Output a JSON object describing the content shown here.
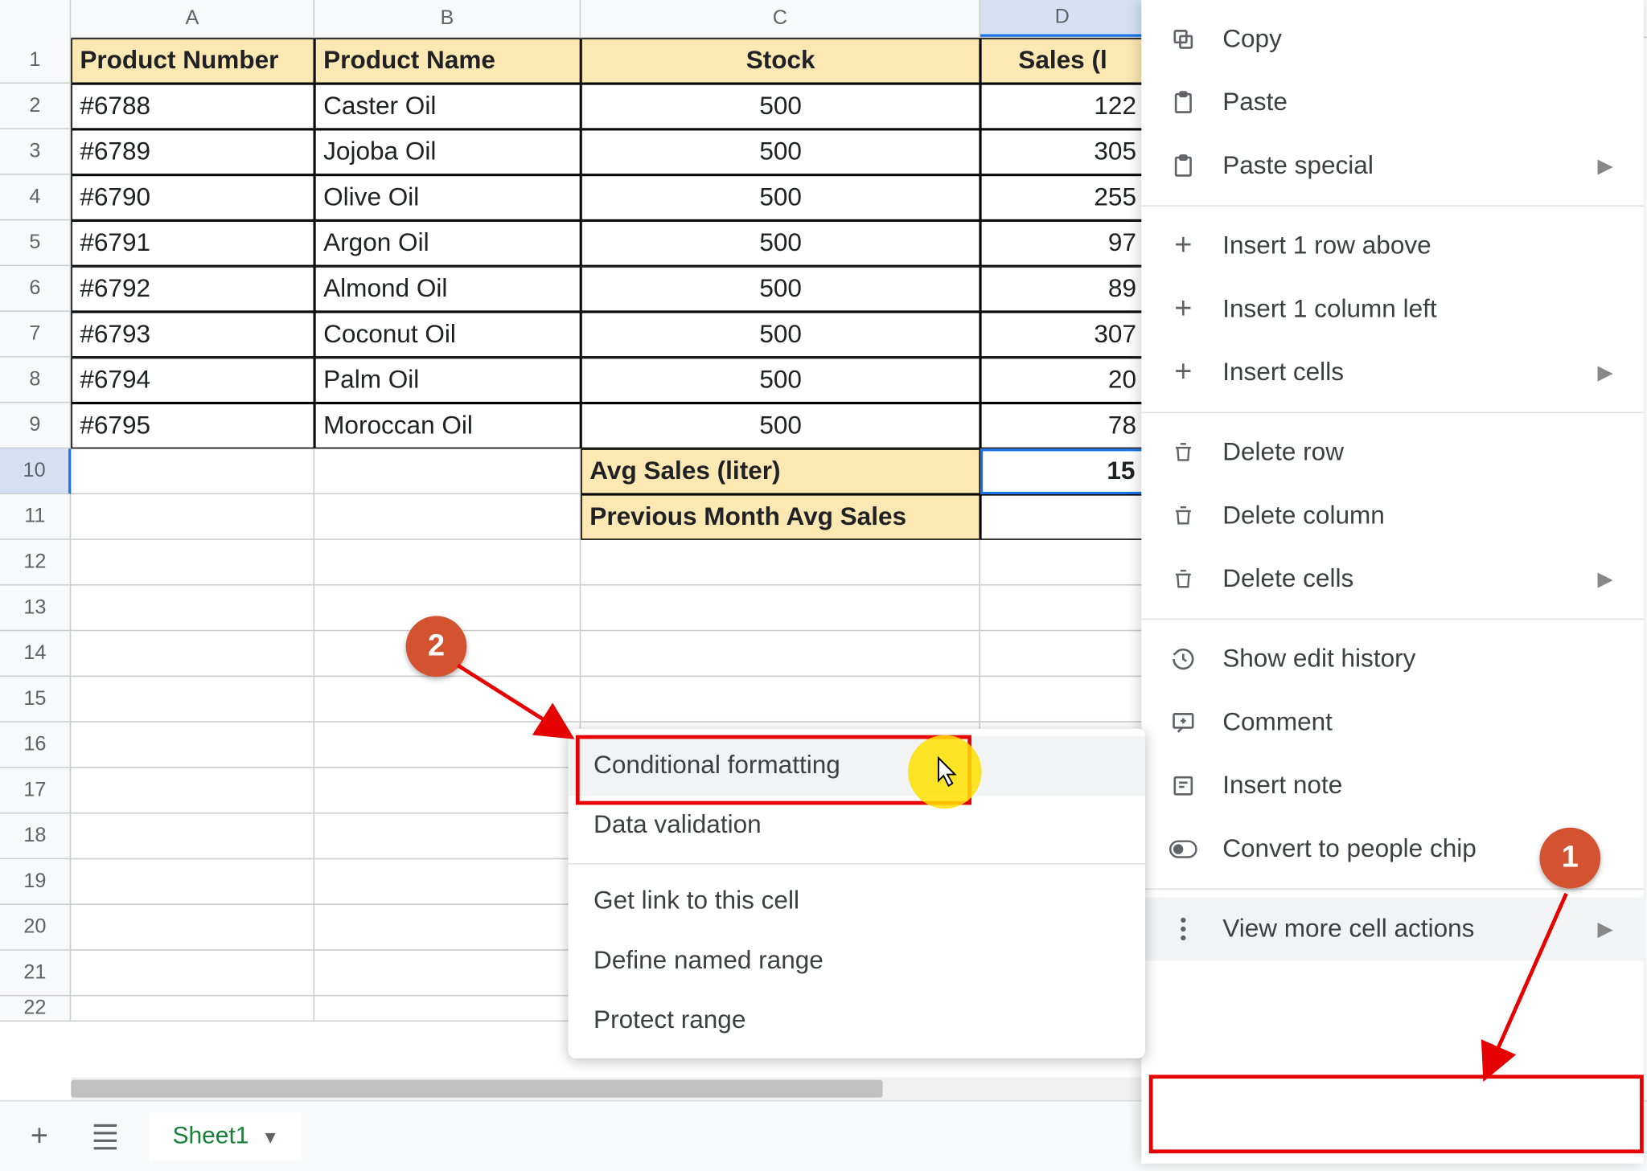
{
  "columns": [
    "A",
    "B",
    "C",
    "D"
  ],
  "rowNums": [
    1,
    2,
    3,
    4,
    5,
    6,
    7,
    8,
    9,
    10,
    11,
    12,
    13,
    14,
    15,
    16,
    17,
    18,
    19,
    20,
    21,
    22
  ],
  "headers": {
    "A": "Product Number",
    "B": "Product Name",
    "C": "Stock",
    "D": "Sales (l"
  },
  "data": [
    {
      "pn": "#6788",
      "name": "Caster Oil",
      "stock": "500",
      "sales": "122"
    },
    {
      "pn": "#6789",
      "name": "Jojoba Oil",
      "stock": "500",
      "sales": "305"
    },
    {
      "pn": "#6790",
      "name": "Olive Oil",
      "stock": "500",
      "sales": "255"
    },
    {
      "pn": "#6791",
      "name": "Argon Oil",
      "stock": "500",
      "sales": "97"
    },
    {
      "pn": "#6792",
      "name": "Almond Oil",
      "stock": "500",
      "sales": "89"
    },
    {
      "pn": "#6793",
      "name": "Coconut Oil",
      "stock": "500",
      "sales": "307"
    },
    {
      "pn": "#6794",
      "name": "Palm Oil",
      "stock": "500",
      "sales": "20"
    },
    {
      "pn": "#6795",
      "name": "Moroccan Oil",
      "stock": "500",
      "sales": "78"
    }
  ],
  "summary": {
    "avgLabel": "Avg Sales (liter)",
    "avgVal": "15",
    "prevLabel": "Previous Month Avg Sales"
  },
  "mainMenu": {
    "copy": "Copy",
    "paste": "Paste",
    "pasteSpecial": "Paste special",
    "insertRow": "Insert 1 row above",
    "insertCol": "Insert 1 column left",
    "insertCells": "Insert cells",
    "delRow": "Delete row",
    "delCol": "Delete column",
    "delCells": "Delete cells",
    "history": "Show edit history",
    "comment": "Comment",
    "note": "Insert note",
    "chip": "Convert to people chip",
    "more": "View more cell actions"
  },
  "subMenu": {
    "condFmt": "Conditional formatting",
    "dataVal": "Data validation",
    "getLink": "Get link to this cell",
    "namedRange": "Define named range",
    "protect": "Protect range"
  },
  "sheetTab": "Sheet1",
  "callouts": {
    "c1": "1",
    "c2": "2"
  }
}
